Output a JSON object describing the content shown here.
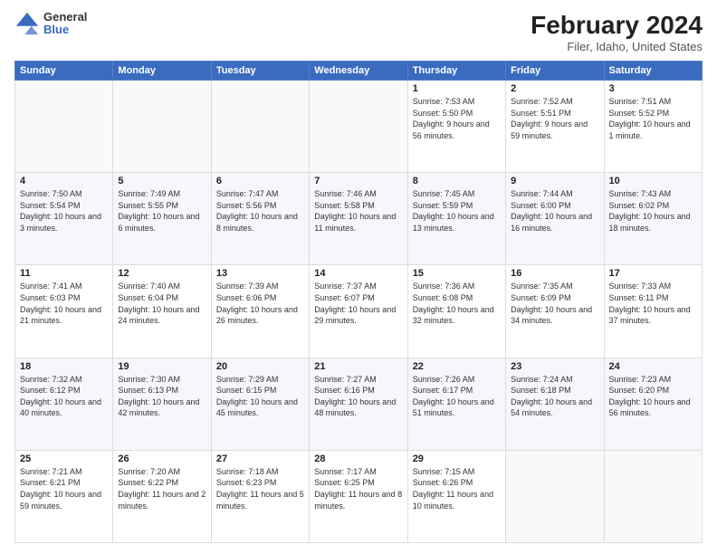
{
  "logo": {
    "general": "General",
    "blue": "Blue"
  },
  "header": {
    "title": "February 2024",
    "subtitle": "Filer, Idaho, United States"
  },
  "days_of_week": [
    "Sunday",
    "Monday",
    "Tuesday",
    "Wednesday",
    "Thursday",
    "Friday",
    "Saturday"
  ],
  "weeks": [
    [
      {
        "day": "",
        "info": ""
      },
      {
        "day": "",
        "info": ""
      },
      {
        "day": "",
        "info": ""
      },
      {
        "day": "",
        "info": ""
      },
      {
        "day": "1",
        "info": "Sunrise: 7:53 AM\nSunset: 5:50 PM\nDaylight: 9 hours and 56 minutes."
      },
      {
        "day": "2",
        "info": "Sunrise: 7:52 AM\nSunset: 5:51 PM\nDaylight: 9 hours and 59 minutes."
      },
      {
        "day": "3",
        "info": "Sunrise: 7:51 AM\nSunset: 5:52 PM\nDaylight: 10 hours and 1 minute."
      }
    ],
    [
      {
        "day": "4",
        "info": "Sunrise: 7:50 AM\nSunset: 5:54 PM\nDaylight: 10 hours and 3 minutes."
      },
      {
        "day": "5",
        "info": "Sunrise: 7:49 AM\nSunset: 5:55 PM\nDaylight: 10 hours and 6 minutes."
      },
      {
        "day": "6",
        "info": "Sunrise: 7:47 AM\nSunset: 5:56 PM\nDaylight: 10 hours and 8 minutes."
      },
      {
        "day": "7",
        "info": "Sunrise: 7:46 AM\nSunset: 5:58 PM\nDaylight: 10 hours and 11 minutes."
      },
      {
        "day": "8",
        "info": "Sunrise: 7:45 AM\nSunset: 5:59 PM\nDaylight: 10 hours and 13 minutes."
      },
      {
        "day": "9",
        "info": "Sunrise: 7:44 AM\nSunset: 6:00 PM\nDaylight: 10 hours and 16 minutes."
      },
      {
        "day": "10",
        "info": "Sunrise: 7:43 AM\nSunset: 6:02 PM\nDaylight: 10 hours and 18 minutes."
      }
    ],
    [
      {
        "day": "11",
        "info": "Sunrise: 7:41 AM\nSunset: 6:03 PM\nDaylight: 10 hours and 21 minutes."
      },
      {
        "day": "12",
        "info": "Sunrise: 7:40 AM\nSunset: 6:04 PM\nDaylight: 10 hours and 24 minutes."
      },
      {
        "day": "13",
        "info": "Sunrise: 7:39 AM\nSunset: 6:06 PM\nDaylight: 10 hours and 26 minutes."
      },
      {
        "day": "14",
        "info": "Sunrise: 7:37 AM\nSunset: 6:07 PM\nDaylight: 10 hours and 29 minutes."
      },
      {
        "day": "15",
        "info": "Sunrise: 7:36 AM\nSunset: 6:08 PM\nDaylight: 10 hours and 32 minutes."
      },
      {
        "day": "16",
        "info": "Sunrise: 7:35 AM\nSunset: 6:09 PM\nDaylight: 10 hours and 34 minutes."
      },
      {
        "day": "17",
        "info": "Sunrise: 7:33 AM\nSunset: 6:11 PM\nDaylight: 10 hours and 37 minutes."
      }
    ],
    [
      {
        "day": "18",
        "info": "Sunrise: 7:32 AM\nSunset: 6:12 PM\nDaylight: 10 hours and 40 minutes."
      },
      {
        "day": "19",
        "info": "Sunrise: 7:30 AM\nSunset: 6:13 PM\nDaylight: 10 hours and 42 minutes."
      },
      {
        "day": "20",
        "info": "Sunrise: 7:29 AM\nSunset: 6:15 PM\nDaylight: 10 hours and 45 minutes."
      },
      {
        "day": "21",
        "info": "Sunrise: 7:27 AM\nSunset: 6:16 PM\nDaylight: 10 hours and 48 minutes."
      },
      {
        "day": "22",
        "info": "Sunrise: 7:26 AM\nSunset: 6:17 PM\nDaylight: 10 hours and 51 minutes."
      },
      {
        "day": "23",
        "info": "Sunrise: 7:24 AM\nSunset: 6:18 PM\nDaylight: 10 hours and 54 minutes."
      },
      {
        "day": "24",
        "info": "Sunrise: 7:23 AM\nSunset: 6:20 PM\nDaylight: 10 hours and 56 minutes."
      }
    ],
    [
      {
        "day": "25",
        "info": "Sunrise: 7:21 AM\nSunset: 6:21 PM\nDaylight: 10 hours and 59 minutes."
      },
      {
        "day": "26",
        "info": "Sunrise: 7:20 AM\nSunset: 6:22 PM\nDaylight: 11 hours and 2 minutes."
      },
      {
        "day": "27",
        "info": "Sunrise: 7:18 AM\nSunset: 6:23 PM\nDaylight: 11 hours and 5 minutes."
      },
      {
        "day": "28",
        "info": "Sunrise: 7:17 AM\nSunset: 6:25 PM\nDaylight: 11 hours and 8 minutes."
      },
      {
        "day": "29",
        "info": "Sunrise: 7:15 AM\nSunset: 6:26 PM\nDaylight: 11 hours and 10 minutes."
      },
      {
        "day": "",
        "info": ""
      },
      {
        "day": "",
        "info": ""
      }
    ]
  ]
}
